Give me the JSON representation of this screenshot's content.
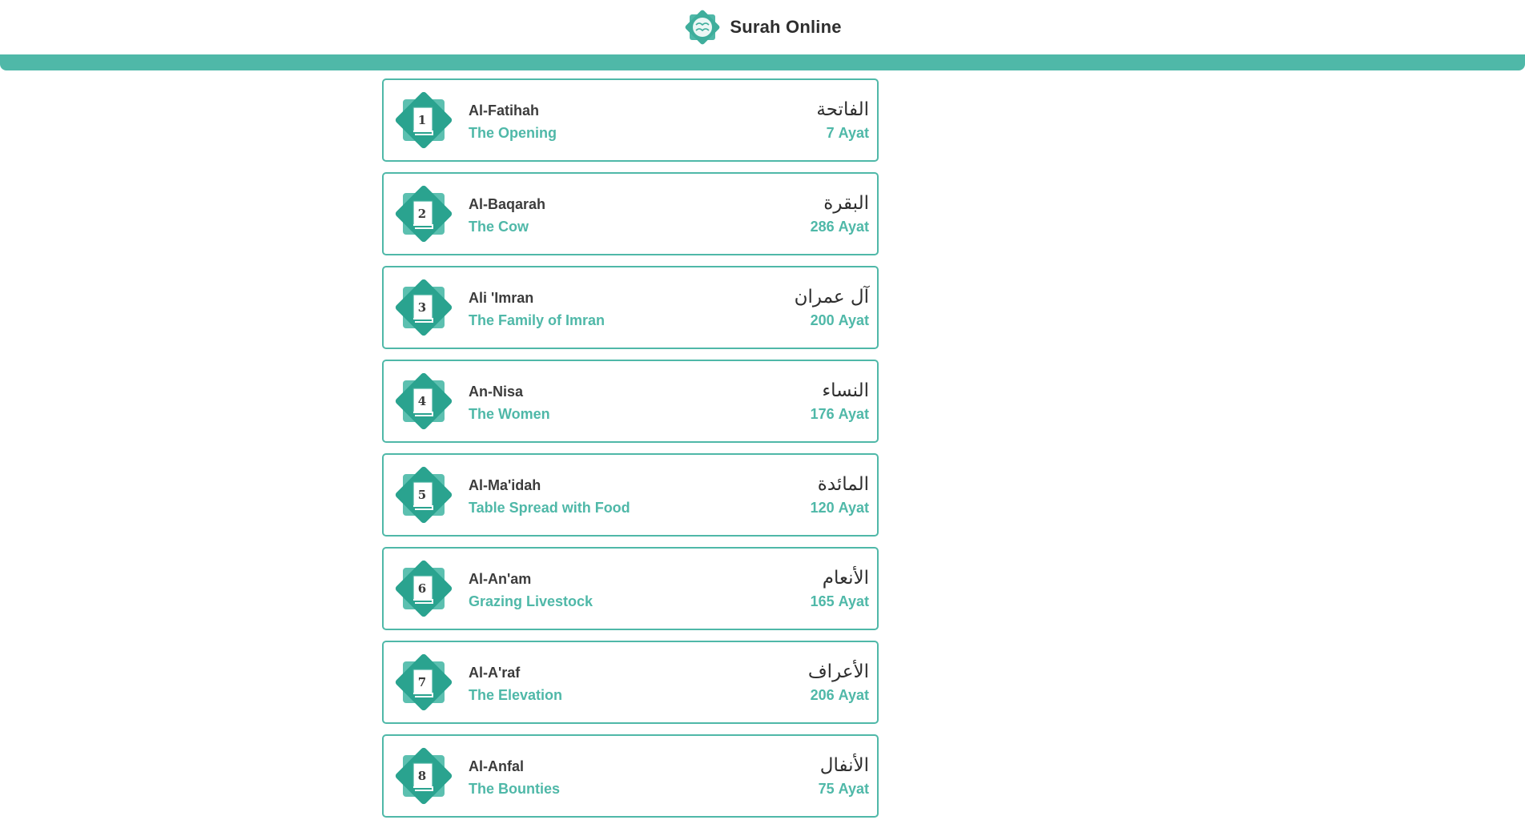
{
  "header": {
    "title": "Surah Online",
    "logo_icon": "star-book-logo-icon"
  },
  "colors": {
    "accent": "#4fb8a8",
    "accent_dark": "#2aa38f",
    "text_dark": "#3c3c3c"
  },
  "ayat_label": "Ayat",
  "surahs": [
    {
      "number": "1",
      "name": "Al-Fatihah",
      "meaning": "The Opening",
      "arabic": "الفاتحة",
      "ayat": "7"
    },
    {
      "number": "2",
      "name": "Al-Baqarah",
      "meaning": "The Cow",
      "arabic": "البقرة",
      "ayat": "286"
    },
    {
      "number": "3",
      "name": "Ali 'Imran",
      "meaning": "The Family of Imran",
      "arabic": "آل عمران",
      "ayat": "200"
    },
    {
      "number": "4",
      "name": "An-Nisa",
      "meaning": "The Women",
      "arabic": "النساء",
      "ayat": "176"
    },
    {
      "number": "5",
      "name": "Al-Ma'idah",
      "meaning": "Table Spread with Food",
      "arabic": "المائدة",
      "ayat": "120"
    },
    {
      "number": "6",
      "name": "Al-An'am",
      "meaning": "Grazing Livestock",
      "arabic": "الأنعام",
      "ayat": "165"
    },
    {
      "number": "7",
      "name": "Al-A'raf",
      "meaning": "The Elevation",
      "arabic": "الأعراف",
      "ayat": "206"
    },
    {
      "number": "8",
      "name": "Al-Anfal",
      "meaning": "The Bounties",
      "arabic": "الأنفال",
      "ayat": "75"
    }
  ]
}
